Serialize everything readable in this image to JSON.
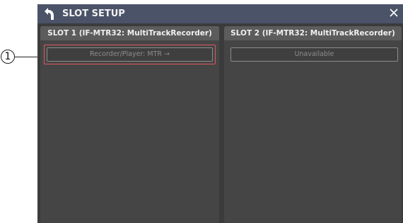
{
  "callout": {
    "number": "1"
  },
  "window": {
    "title": "SLOT SETUP",
    "back_icon": "back-arrow-icon",
    "close_icon": "close-icon"
  },
  "slots": [
    {
      "header": "SLOT 1 (IF-MTR32: MultiTrackRecorder)",
      "button_label": "Recorder/Player: MTR →"
    },
    {
      "header": "SLOT 2 (IF-MTR32: MultiTrackRecorder)",
      "button_label": "Unavailable"
    }
  ],
  "colors": {
    "titlebar": "#4a5368",
    "window_bg": "#3b3b3b",
    "panel_bg": "#454545",
    "panel_header": "#5c5c5c",
    "highlight": "#e0565f"
  }
}
